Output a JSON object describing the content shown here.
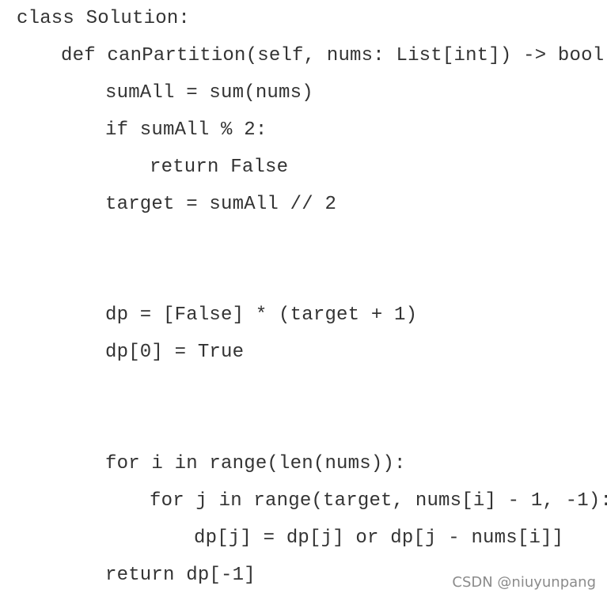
{
  "code": {
    "lines": [
      "class Solution:",
      "def canPartition(self, nums: List[int]) -> bool:",
      "sumAll = sum(nums)",
      "if sumAll % 2:",
      "return False",
      "target = sumAll // 2",
      "dp = [False] * (target + 1)",
      "dp[0] = True",
      "for i in range(len(nums)):",
      "for j in range(target, nums[i] - 1, -1):",
      "dp[j] = dp[j] or dp[j - nums[i]]",
      "return dp[-1]"
    ]
  },
  "watermark": {
    "text": "CSDN @niuyunpang"
  }
}
